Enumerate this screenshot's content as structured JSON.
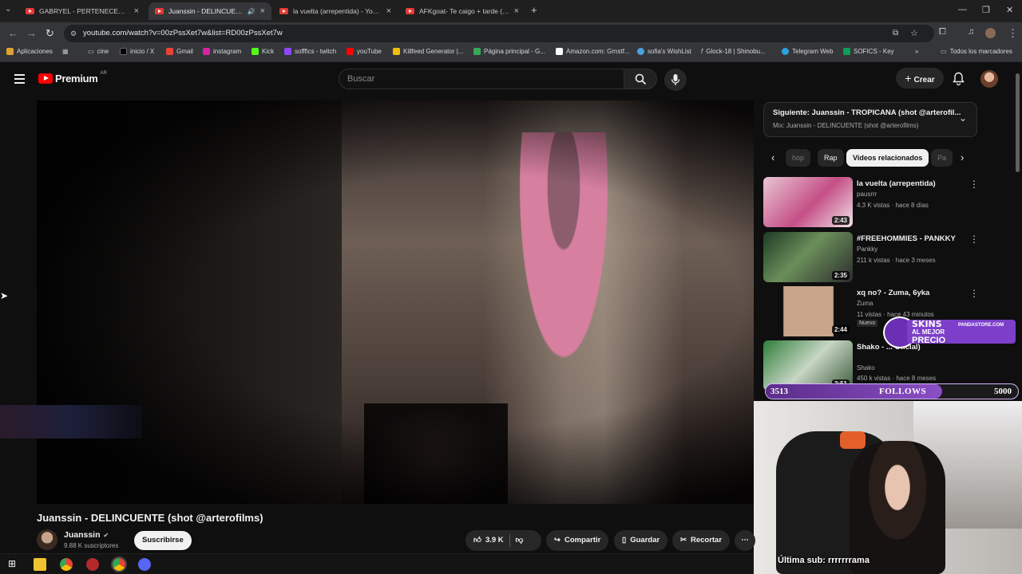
{
  "browser": {
    "tabs": [
      {
        "title": "GABRYEL - PERTENECEMOS (V..."
      },
      {
        "title": "Juanssin - DELINCUENTE (sh..."
      },
      {
        "title": "la vuelta (arrepentida) - YouTu..."
      },
      {
        "title": "AFKgoat- Te caigo + tarde (Vid..."
      }
    ],
    "url": "youtube.com/watch?v=00zPssXet7w&list=RD00zPssXet7w",
    "bookmarks": [
      {
        "label": "Aplicaciones"
      },
      {
        "label": "cine"
      },
      {
        "label": "inicio / X"
      },
      {
        "label": "Gmail"
      },
      {
        "label": "instagram"
      },
      {
        "label": "Kick"
      },
      {
        "label": "sofffics - twitch"
      },
      {
        "label": "youTube"
      },
      {
        "label": "Killfeed Generator |..."
      },
      {
        "label": "Página principal - G..."
      },
      {
        "label": "Amazon.com: Grnstf..."
      },
      {
        "label": "sofia's WishList"
      },
      {
        "label": "Glock-18 | Shinobu..."
      },
      {
        "label": "Telegram Web"
      },
      {
        "label": "SOFICS - Key"
      }
    ],
    "all_bookmarks": "Todos los marcadores"
  },
  "youtube": {
    "logo_text": "Premium",
    "logo_region": "AR",
    "search_placeholder": "Buscar",
    "create_label": "Crear"
  },
  "video": {
    "title": "Juanssin - DELINCUENTE (shot @arterofilms)",
    "channel": "Juanssin",
    "subscribers": "9.88 K suscriptores",
    "subscribe_label": "Suscribirse",
    "likes": "3.9 K",
    "share_label": "Compartir",
    "save_label": "Guardar",
    "clip_label": "Recortar"
  },
  "next_up": {
    "title": "Siguiente: Juanssin - TROPICANA (shot @arterofil...",
    "subtitle": "Mix: Juanssin - DELINCUENTE (shot @arterofilms)"
  },
  "chips": [
    "hop",
    "Rap",
    "Videos relacionados",
    "Pa"
  ],
  "related": [
    {
      "title": "la vuelta (arrepentida)",
      "channel": "pausrrr",
      "meta": "4.3 K vistas · hace 8 días",
      "duration": "2:43"
    },
    {
      "title": "#FREEHOMMIES - PANKKY",
      "channel": "Pankky",
      "meta": "211 k vistas · hace 3 meses",
      "duration": "2:35"
    },
    {
      "title": "xq no? - Zuma, 6yka",
      "channel": "Zuma",
      "meta": "11 vistas · hace 43 minutos",
      "duration": "2:44",
      "badge": "Nuevo"
    },
    {
      "title": "Shako - ... Oficial)",
      "channel": "Shako",
      "meta": "450 k vistas · hace 8 meses",
      "duration": "2:51"
    }
  ],
  "overlay": {
    "ad_line1": "SKINS",
    "ad_line2": "AL MEJOR",
    "ad_line3": "PRECIO",
    "ad_site": "PANDASTORE.COM",
    "follows_current": "3513",
    "follows_label": "FOLLOWS",
    "follows_goal": "5000",
    "follows_progress": 0.7,
    "last_sub": "Última sub: rrrrrrrama"
  },
  "colors": {
    "accent_red": "#ff0000",
    "progress": "#7a3bb8"
  }
}
